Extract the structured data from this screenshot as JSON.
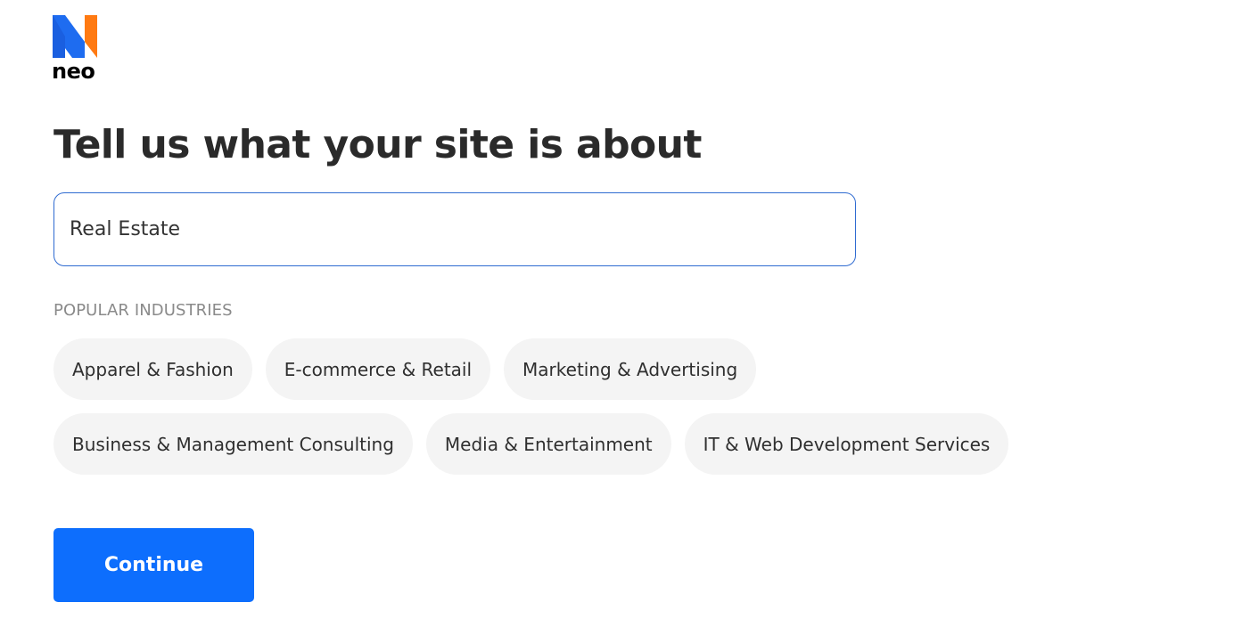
{
  "brand": {
    "name": "neo",
    "logo_icon": "neo-logo-icon",
    "colors": {
      "blue": "#1e6cf0",
      "orange": "#ff7a12"
    }
  },
  "page": {
    "title": "Tell us what your site is about"
  },
  "site_input": {
    "value": "Real Estate"
  },
  "popular": {
    "label": "POPULAR INDUSTRIES",
    "row1": [
      {
        "label": "Apparel & Fashion"
      },
      {
        "label": "E-commerce & Retail"
      },
      {
        "label": "Marketing & Advertising"
      }
    ],
    "row2": [
      {
        "label": "Business & Management Consulting"
      },
      {
        "label": "Media & Entertainment"
      },
      {
        "label": "IT & Web Development Services"
      }
    ]
  },
  "actions": {
    "continue_label": "Continue",
    "accent_color": "#0d6efd"
  }
}
